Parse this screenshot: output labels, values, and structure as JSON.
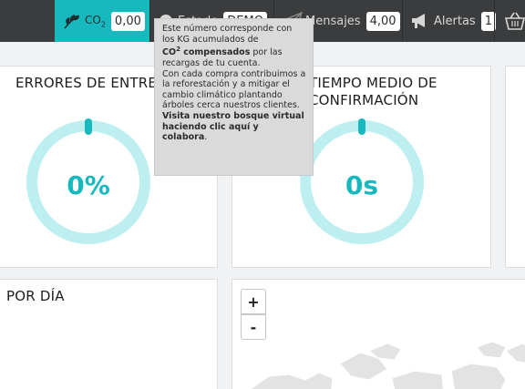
{
  "topbar": {
    "co2": {
      "label": "CO",
      "label_sub": "2",
      "value": "0,00",
      "icon": "leaf-icon"
    },
    "estado": {
      "label": "Estado",
      "value": "DEMO",
      "icon": "status-icon"
    },
    "mensajes": {
      "label": "Mensajes",
      "value": "4,00",
      "icon": "paper-plane-icon"
    },
    "alertas": {
      "label": "Alertas",
      "value": "1",
      "icon": "megaphone-icon"
    },
    "cart": {
      "icon": "basket-icon"
    }
  },
  "cards": {
    "errores": {
      "title": "ERRORES DE ENTREGA",
      "value": "0%",
      "progress": 0
    },
    "tiempo": {
      "title_line1": "TIEMPO MEDIO DE",
      "title_line2": "CONFIRMACIÓN",
      "value": "0s",
      "progress": 0
    },
    "por_dia": {
      "title": "POR DÍA"
    },
    "map": {
      "zoom_in": "+",
      "zoom_out": "-"
    }
  },
  "tooltip": {
    "p1": "Este número corresponde con los KG acumulados de",
    "bold1a": "CO",
    "bold1sup": "2",
    "bold1b": " compensados",
    "p2": " por las recargas de tu cuenta.",
    "p3": "Con cada compra contribuimos a la reforestación y a mitigar el cambio climático plantando árboles cerca nuestros clientes.",
    "bold2": "Visita nuestro bosque virtual haciendo clic aquí y colabora",
    "end": "."
  },
  "colors": {
    "accent": "#17b8be",
    "topbar": "#3b3c3d",
    "ring": "#bdeef0"
  }
}
